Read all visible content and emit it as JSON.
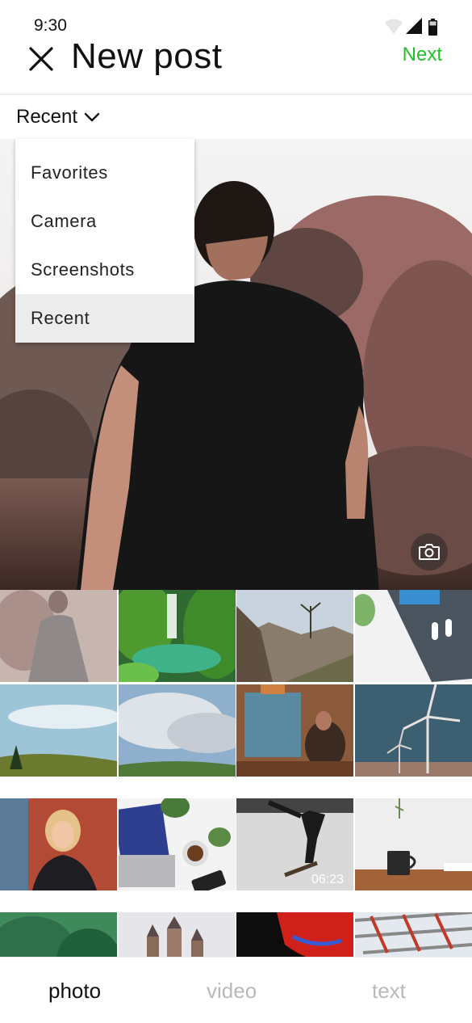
{
  "status_bar": {
    "time": "9:30",
    "icons": [
      "wifi-icon",
      "cellular-signal-icon",
      "battery-icon"
    ]
  },
  "header": {
    "title": "New post",
    "next_label": "Next",
    "close_icon": "close-icon",
    "accent_color": "#22c02a"
  },
  "album_selector": {
    "label": "Recent",
    "icon": "chevron-down-icon"
  },
  "album_dropdown": {
    "items": [
      {
        "label": "Favorites"
      },
      {
        "label": "Camera"
      },
      {
        "label": "Screenshots"
      },
      {
        "label": "Recent",
        "selected": true
      }
    ]
  },
  "preview": {
    "camera_icon": "camera-icon"
  },
  "grid": {
    "video_duration": "06:23"
  },
  "tabs": [
    {
      "label": "photo",
      "active": true
    },
    {
      "label": "video",
      "active": false
    },
    {
      "label": "text",
      "active": false
    }
  ]
}
